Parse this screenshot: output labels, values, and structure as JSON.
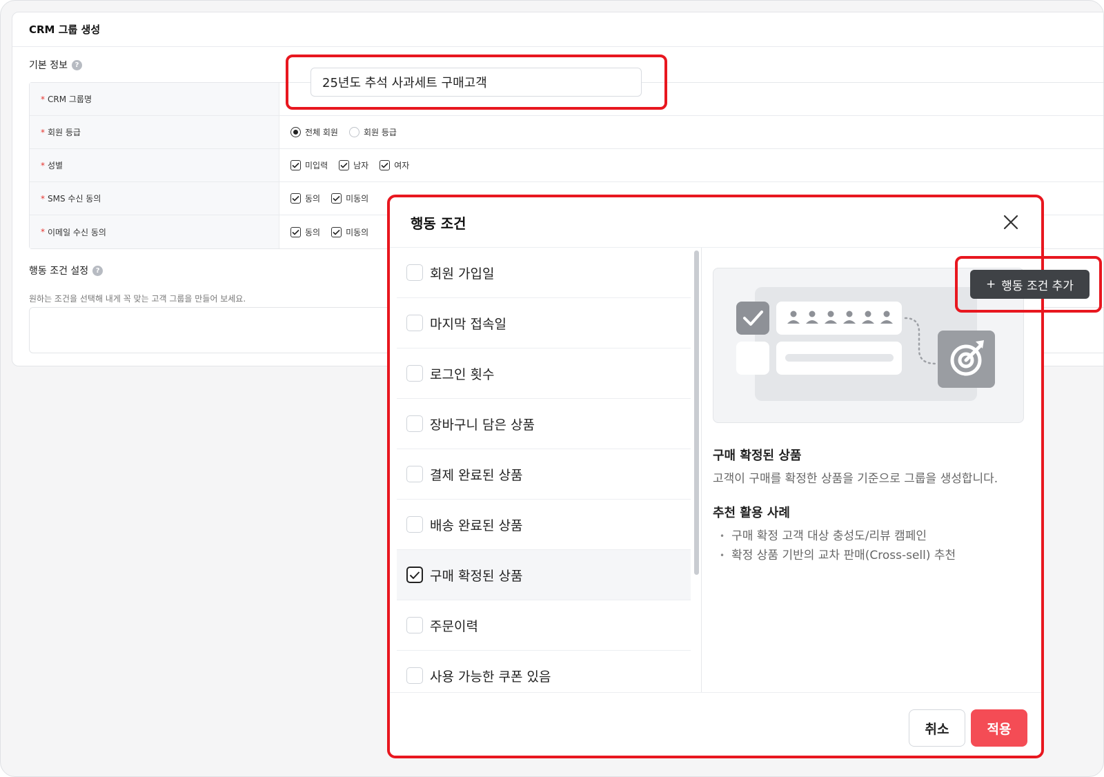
{
  "page": {
    "title": "CRM 그룹 생성",
    "basic_info_title": "기본 정보",
    "help_glyph": "?"
  },
  "form": {
    "rows": [
      {
        "required": "*",
        "label": "CRM 그룹명"
      },
      {
        "required": "*",
        "label": "회원 등급"
      },
      {
        "required": "*",
        "label": "성별"
      },
      {
        "required": "*",
        "label": "SMS 수신 동의"
      },
      {
        "required": "*",
        "label": "이메일 수신 동의"
      }
    ],
    "group_name_value": "25년도 추석 사과세트 구매고객",
    "member_grade_options": [
      {
        "label": "전체 회원",
        "checked": true
      },
      {
        "label": "회원 등급",
        "checked": false
      }
    ],
    "gender_options": [
      {
        "label": "미입력",
        "checked": true
      },
      {
        "label": "남자",
        "checked": true
      },
      {
        "label": "여자",
        "checked": true
      }
    ],
    "sms_options": [
      {
        "label": "동의",
        "checked": true
      },
      {
        "label": "미동의",
        "checked": true
      }
    ],
    "email_options": [
      {
        "label": "동의",
        "checked": true
      },
      {
        "label": "미동의",
        "checked": true
      }
    ]
  },
  "behavior_section": {
    "title": "행동 조건 설정",
    "description": "원하는 조건을 선택해 내게 꼭 맞는 고객 그룹을 만들어 보세요."
  },
  "modal": {
    "title": "행동 조건",
    "close_icon": "close-icon",
    "conditions": [
      {
        "label": "회원 가입일",
        "checked": false
      },
      {
        "label": "마지막 접속일",
        "checked": false
      },
      {
        "label": "로그인 횟수",
        "checked": false
      },
      {
        "label": "장바구니 담은 상품",
        "checked": false
      },
      {
        "label": "결제 완료된 상품",
        "checked": false
      },
      {
        "label": "배송 완료된 상품",
        "checked": false
      },
      {
        "label": "구매 확정된 상품",
        "checked": true
      },
      {
        "label": "주문이력",
        "checked": false
      },
      {
        "label": "사용 가능한 쿠폰 있음",
        "checked": false
      }
    ],
    "detail": {
      "title": "구매 확정된 상품",
      "description": "고객이 구매를 확정한 상품을 기준으로 그룹을 생성합니다.",
      "rec_title": "추천 활용 사례",
      "rec_items": [
        "구매 확정 고객 대상 충성도/리뷰 캠페인",
        "확정 상품 기반의 교차 판매(Cross-sell) 추천"
      ]
    },
    "add_button": {
      "icon": "+",
      "label": "행동 조건 추가"
    },
    "cancel_label": "취소",
    "apply_label": "적용"
  },
  "colors": {
    "highlight": "#e8171f",
    "apply_button": "#f44c55",
    "add_button": "#3f4246",
    "required_mark": "#e5352f"
  }
}
